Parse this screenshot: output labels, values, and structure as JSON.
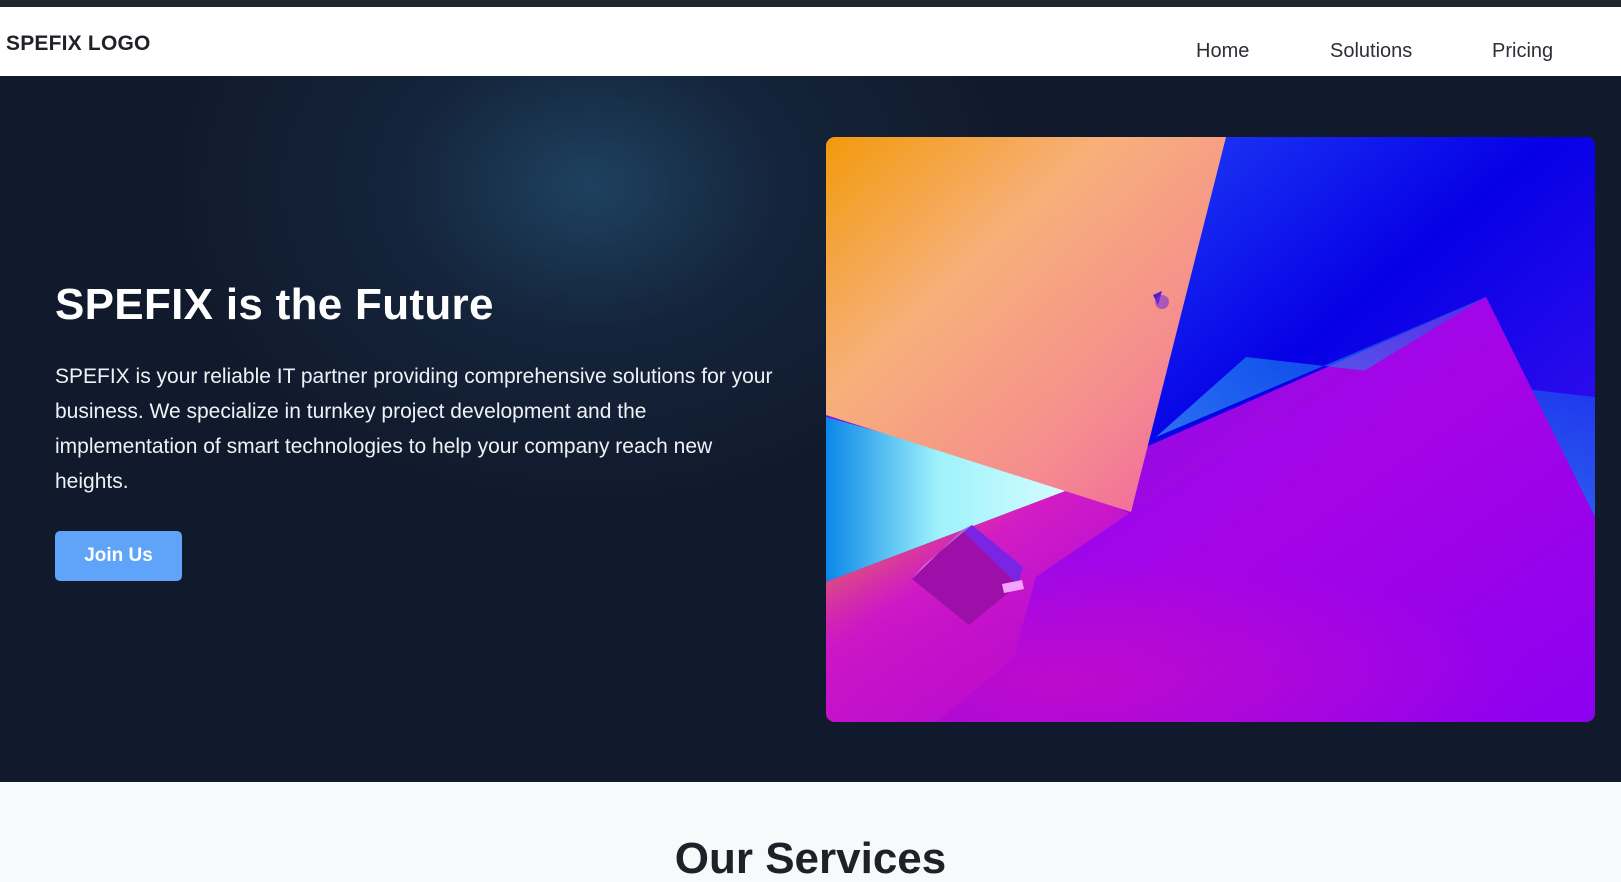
{
  "header": {
    "logo_text": "SPEFIX LOGO",
    "nav": {
      "home": "Home",
      "solutions": "Solutions",
      "pricing": "Pricing"
    }
  },
  "hero": {
    "title": "SPEFIX is the Future",
    "description": "SPEFIX is your reliable IT partner providing comprehensive solutions for your business. We specialize in turnkey project development and the implementation of smart technologies to help your company reach new heights.",
    "cta_label": "Join Us",
    "image": "abstract-gradient-3d-shapes"
  },
  "services": {
    "title": "Our Services"
  },
  "colors": {
    "top_strip": "#23272d",
    "hero_background": "#111a2c",
    "cta_background": "#5fa4f8",
    "services_background": "#f7f9fb"
  }
}
